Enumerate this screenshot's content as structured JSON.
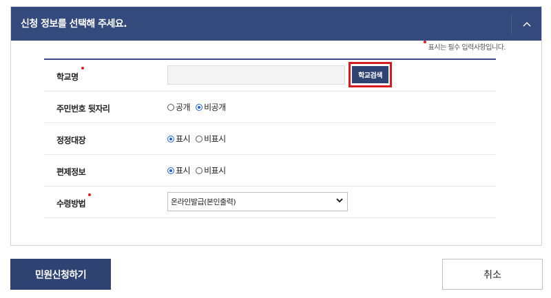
{
  "header": {
    "title": "신청 정보를 선택해 주세요."
  },
  "required_note": "표시는 필수 입력사항입니다.",
  "fields": {
    "school": {
      "label": "학교명",
      "value": "",
      "search_label": "학교검색"
    },
    "id_suffix": {
      "label": "주민번호 뒷자리",
      "options": [
        "공개",
        "비공개"
      ],
      "selected": "비공개"
    },
    "correction_ledger": {
      "label": "정정대장",
      "options": [
        "표시",
        "비표시"
      ],
      "selected": "표시"
    },
    "transfer_info": {
      "label": "편제정보",
      "options": [
        "표시",
        "비표시"
      ],
      "selected": "표시"
    },
    "receipt_method": {
      "label": "수령방법",
      "selected": "온라인발급(본인출력)"
    }
  },
  "buttons": {
    "submit": "민원신청하기",
    "cancel": "취소"
  },
  "colors": {
    "header_bg": "#344a7c",
    "primary_btn": "#2e4372",
    "required_dot": "#e01d1d",
    "highlight_border": "#d6191d"
  }
}
